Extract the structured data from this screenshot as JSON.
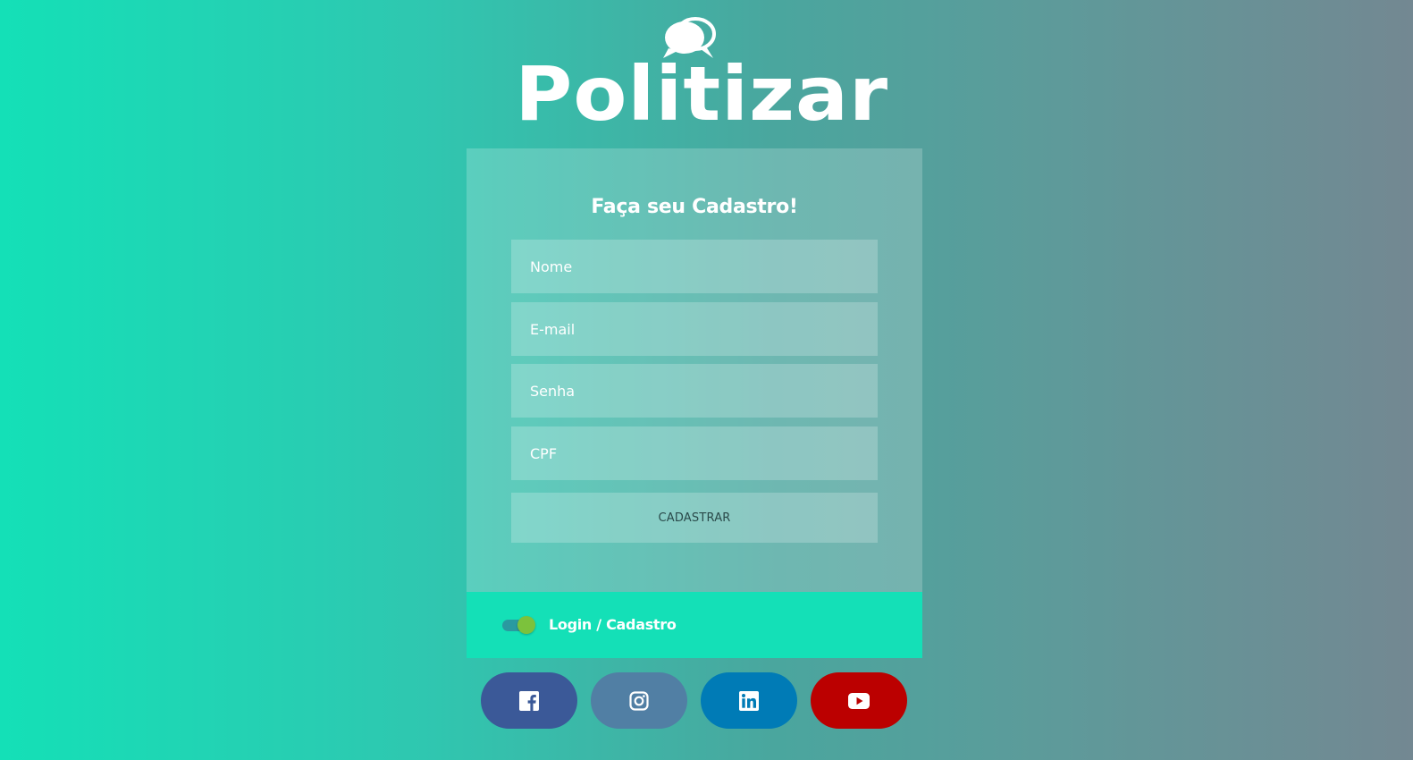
{
  "brand": {
    "logo_text": "Politizar",
    "logo_icon": "speech-bubbles-icon"
  },
  "form": {
    "title": "Faça seu Cadastro!",
    "fields": {
      "nome": {
        "placeholder": "Nome",
        "value": ""
      },
      "email": {
        "placeholder": "E-mail",
        "value": ""
      },
      "senha": {
        "placeholder": "Senha",
        "value": ""
      },
      "cpf": {
        "placeholder": "CPF",
        "value": ""
      }
    },
    "submit_label": "CADASTRAR"
  },
  "toggle": {
    "label": "Login / Cadastro",
    "checked": true
  },
  "social": [
    {
      "name": "Facebook",
      "icon": "facebook-icon",
      "color": "#3b5998"
    },
    {
      "name": "Instagram",
      "icon": "instagram-icon",
      "color": "#517fa4"
    },
    {
      "name": "LinkedIn",
      "icon": "linkedin-icon",
      "color": "#007bb6"
    },
    {
      "name": "YouTube",
      "icon": "youtube-icon",
      "color": "#bb0000"
    }
  ],
  "colors": {
    "accent": "#14e0b7",
    "gradient_end": "#738892",
    "toggle_knob": "#7cc23c"
  }
}
